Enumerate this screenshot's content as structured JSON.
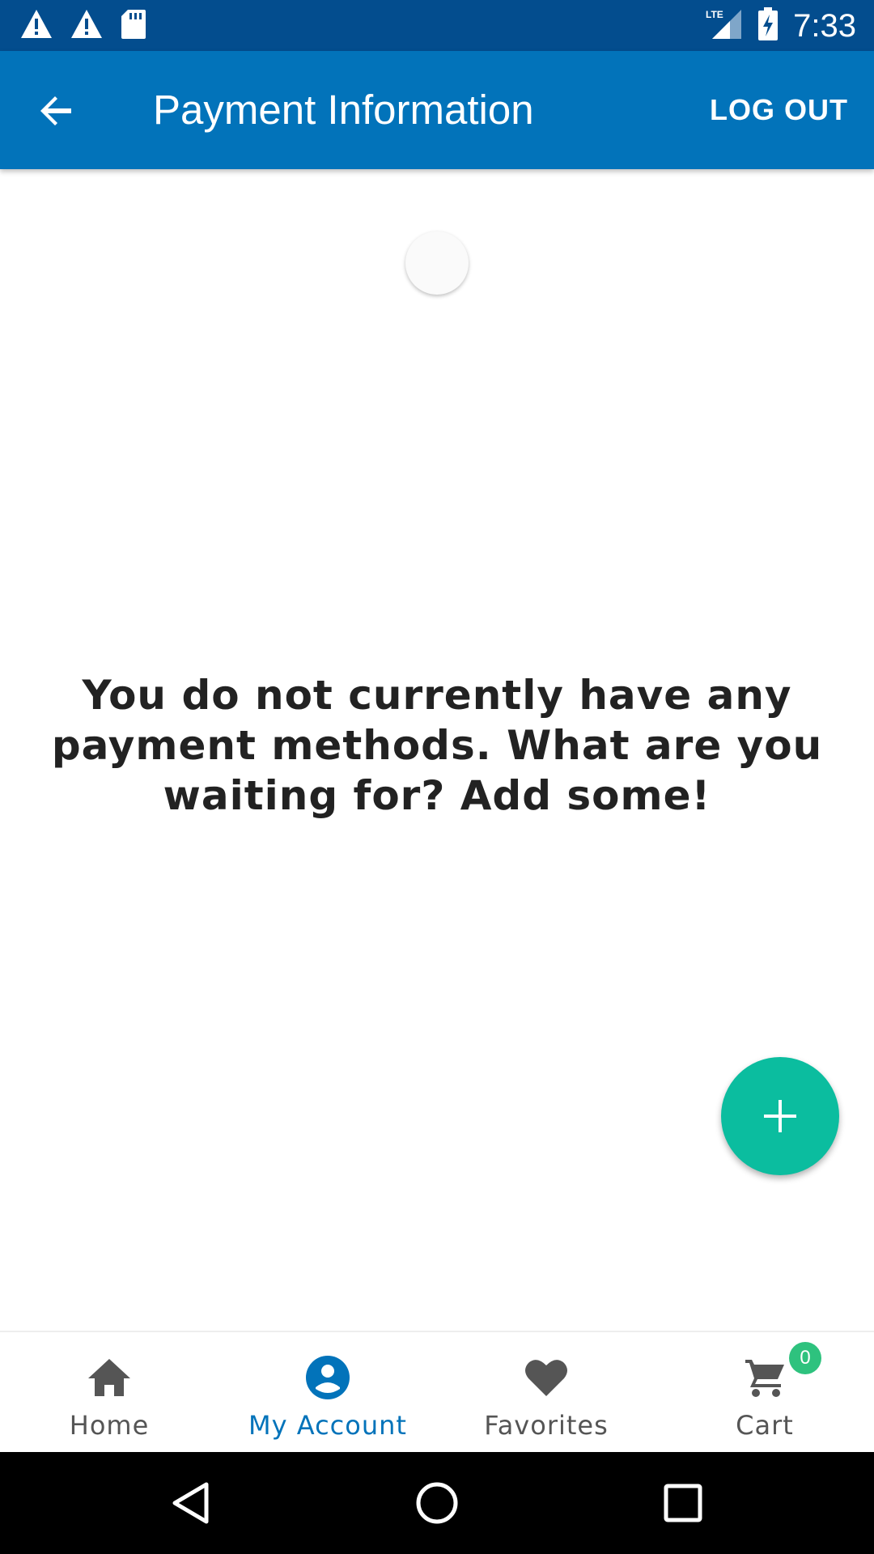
{
  "status_bar": {
    "time": "7:33",
    "left_icons": [
      "warning-icon",
      "warning-icon",
      "sd-card-icon"
    ],
    "right_icons": [
      "lte-signal-icon",
      "battery-charging-icon"
    ],
    "network_label": "LTE"
  },
  "app_bar": {
    "title": "Payment Information",
    "logout_label": "LOG OUT",
    "back_icon": "arrow-back-icon"
  },
  "content": {
    "empty_message": "You do not currently have any payment methods. What are you waiting for? Add some!"
  },
  "fab": {
    "icon": "plus-icon"
  },
  "bottom_nav": {
    "items": [
      {
        "label": "Home",
        "icon": "home-icon",
        "active": false
      },
      {
        "label": "My Account",
        "icon": "account-icon",
        "active": true
      },
      {
        "label": "Favorites",
        "icon": "heart-icon",
        "active": false
      },
      {
        "label": "Cart",
        "icon": "cart-icon",
        "active": false,
        "badge": "0"
      }
    ]
  },
  "colors": {
    "status_bar": "#034d8e",
    "app_bar": "#0273ba",
    "fab": "#0bbd9f",
    "active_nav": "#0273ba",
    "inactive_nav": "#555555",
    "badge": "#2ec27e"
  }
}
